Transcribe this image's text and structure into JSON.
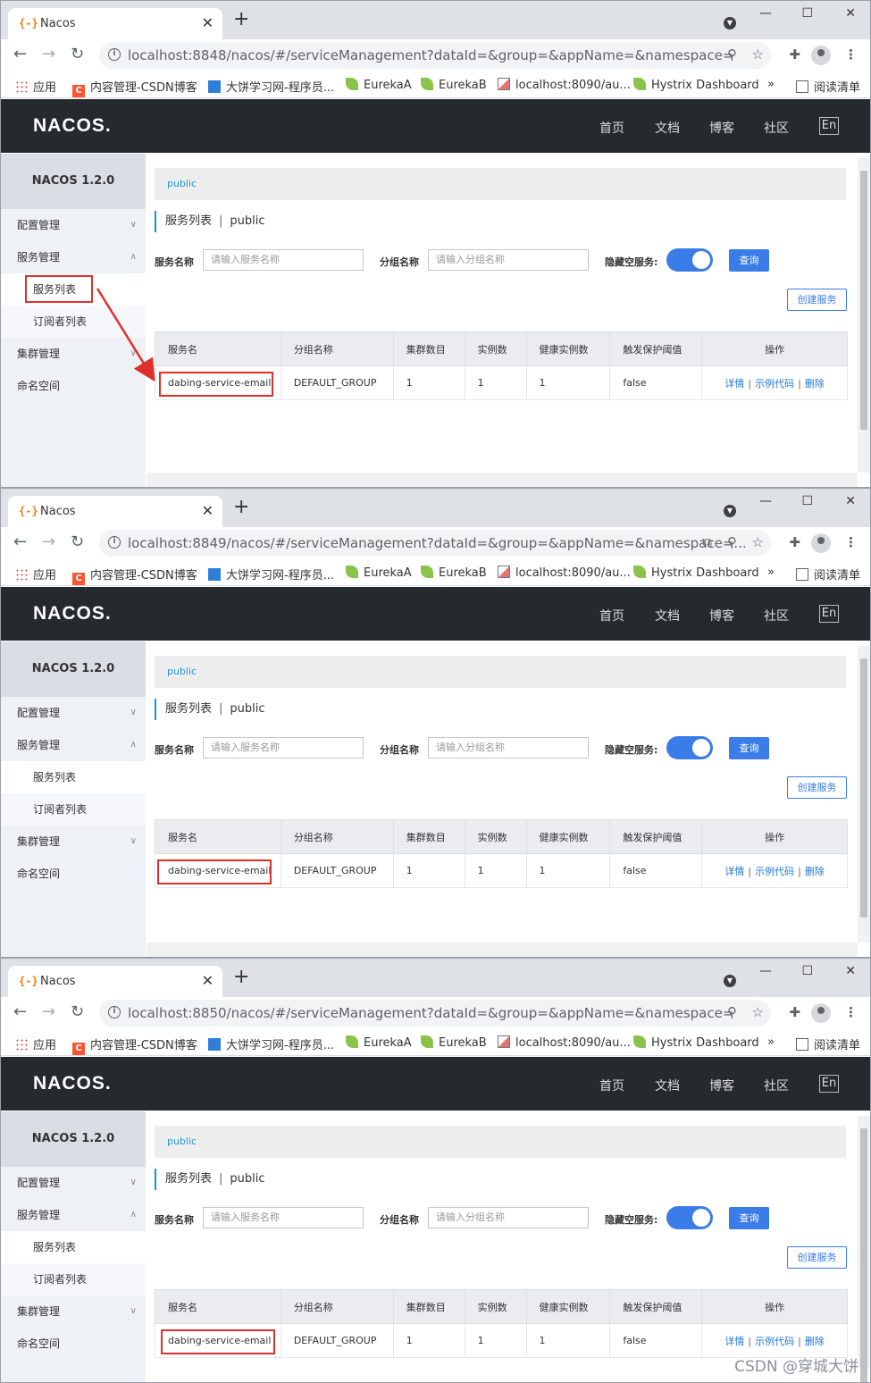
{
  "tab": {
    "title": "Nacos",
    "close": "✕",
    "new": "+"
  },
  "window_controls": {
    "min": "—",
    "max": "☐",
    "close": "✕"
  },
  "urls": [
    "localhost:8848/nacos/#/serviceManagement?dataId=&group=&appName=&namespace=",
    "localhost:8849/nacos/#/serviceManagement?dataId=&group=&appName=&namespace=...",
    "localhost:8850/nacos/#/serviceManagement?dataId=&group=&appName=&namespace="
  ],
  "bookmarks": [
    "应用",
    "内容管理-CSDN博客",
    "大饼学习网-程序员...",
    "EurekaA",
    "EurekaB",
    "localhost:8090/au...",
    "Hystrix Dashboard",
    "»",
    "阅读清单"
  ],
  "header": {
    "logo": "NACOS.",
    "nav": [
      "首页",
      "文档",
      "博客",
      "社区"
    ],
    "lang": "En"
  },
  "sidebar": {
    "title": "NACOS 1.2.0",
    "items": [
      "配置管理",
      "服务管理",
      "服务列表",
      "订阅者列表",
      "集群管理",
      "命名空间"
    ]
  },
  "breadcrumb": "public",
  "page_title": {
    "main": "服务列表",
    "sep": "|",
    "ns": "public"
  },
  "filters": {
    "service_label": "服务名称",
    "service_placeholder": "请输入服务名称",
    "group_label": "分组名称",
    "group_placeholder": "请输入分组名称",
    "hide_empty_label": "隐藏空服务:",
    "hide_empty_on": true,
    "query": "查询"
  },
  "create_button": "创建服务",
  "table": {
    "headers": [
      "服务名",
      "分组名称",
      "集群数目",
      "实例数",
      "健康实例数",
      "触发保护阈值",
      "操作"
    ],
    "row": [
      "dabing-service-email",
      "DEFAULT_GROUP",
      "1",
      "1",
      "1",
      "false"
    ],
    "ops": [
      "详情",
      "示例代码",
      "删除"
    ]
  },
  "watermark": "CSDN @穿城大饼",
  "colors": {
    "accent": "#3b7de8",
    "header_bg": "#252a2f",
    "highlight": "#e0302c"
  }
}
